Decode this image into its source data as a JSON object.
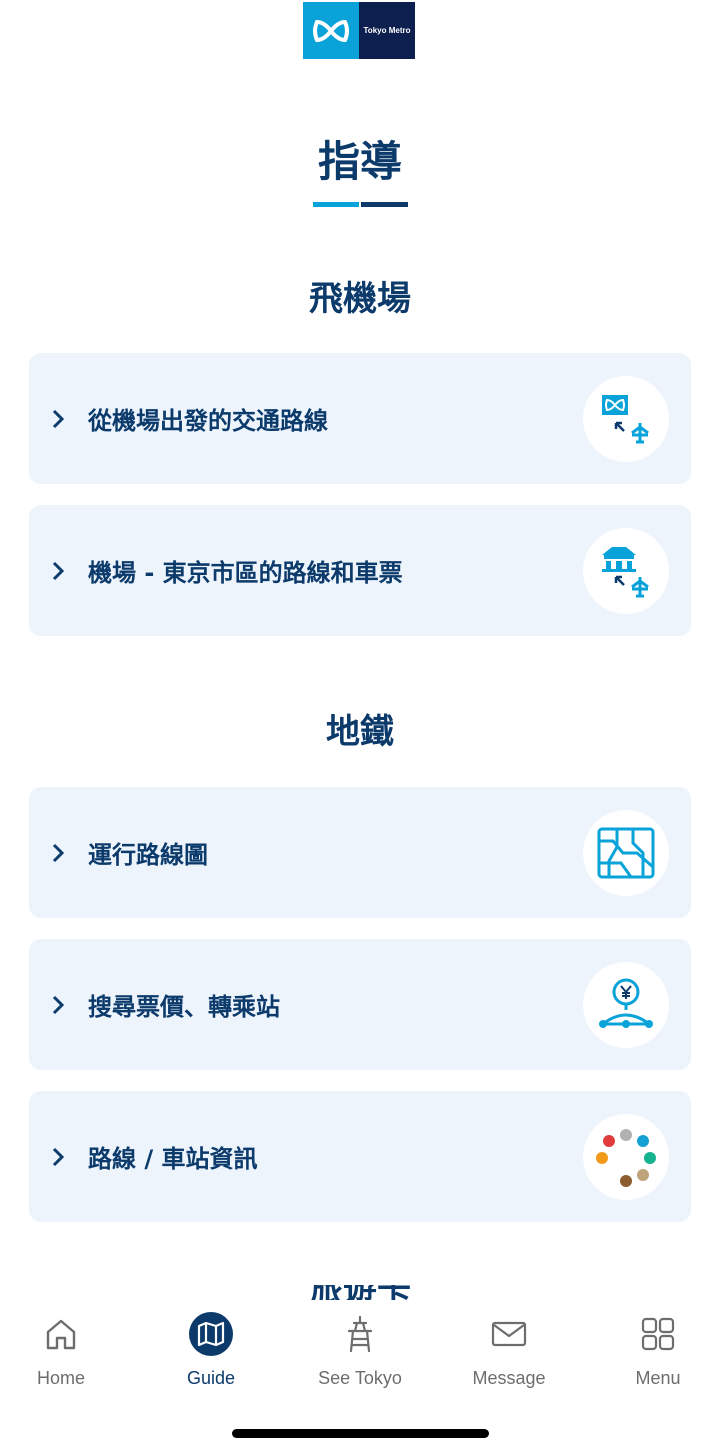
{
  "brand": {
    "logo_text": "Tokyo Metro"
  },
  "page": {
    "title": "指導"
  },
  "sections": [
    {
      "title": "飛機場",
      "items": [
        {
          "label": "從機場出發的交通路線",
          "icon": "metro-airplane-icon"
        },
        {
          "label": "機場 - 東京市區的路線和車票",
          "icon": "building-airplane-icon"
        }
      ]
    },
    {
      "title": "地鐵",
      "items": [
        {
          "label": "運行路線圖",
          "icon": "route-map-icon"
        },
        {
          "label": "搜尋票價、轉乘站",
          "icon": "fare-transfer-icon"
        },
        {
          "label": "路線 / 車站資訊",
          "icon": "line-colors-icon"
        }
      ]
    },
    {
      "title": "旅遊卡"
    }
  ],
  "tabbar": {
    "tabs": [
      {
        "label": "Home",
        "icon": "home-icon",
        "active": false
      },
      {
        "label": "Guide",
        "icon": "map-icon",
        "active": true
      },
      {
        "label": "See Tokyo",
        "icon": "tower-icon",
        "active": false
      },
      {
        "label": "Message",
        "icon": "envelope-icon",
        "active": false
      },
      {
        "label": "Menu",
        "icon": "grid-icon",
        "active": false
      }
    ]
  },
  "colors": {
    "navy": "#0b3a6b",
    "accent": "#0aa3d9",
    "card": "#edf4fc"
  }
}
